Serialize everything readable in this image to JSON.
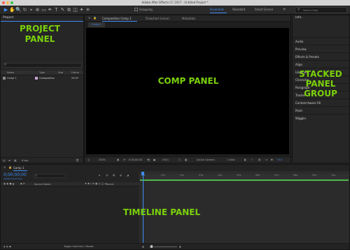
{
  "app": {
    "title": "Adobe After Effects CC 2017 - Untitled Project *"
  },
  "toolbar": {
    "snapping": "Snapping",
    "workspaces": [
      "Essentials",
      "Standard",
      "Small Screen"
    ],
    "active_workspace": "Essentials",
    "search_placeholder": "Search Help"
  },
  "project": {
    "panel_title": "Project",
    "overlay_label": "PROJECT\nPANEL",
    "search_icon": "search-icon",
    "columns": [
      "Name",
      "Type",
      "Size",
      "Frame"
    ],
    "rows": [
      {
        "name": "Comp 1",
        "type": "Composition",
        "frame": "29.97"
      }
    ],
    "footer_bpc": "8 bpc"
  },
  "comp": {
    "tabs": [
      "Composition Comp 1",
      "Flowchart (none)",
      "Metadata"
    ],
    "subtab": "Comp 1",
    "overlay_label": "COMP PANEL",
    "footer": {
      "zoom": "200%",
      "timecode": "0;00;00;00",
      "resolution": "(Full)",
      "camera": "Active Camera",
      "view": "1 View",
      "exposure": "+0.0"
    }
  },
  "right_panels": {
    "header": "Info",
    "items": [
      "Audio",
      "Preview",
      "Effects & Presets",
      "Align",
      "Libraries",
      "Character",
      "Paragraph",
      "Tracker",
      "Content-Aware Fill",
      "Paint",
      "Wiggler"
    ],
    "overlay_label": "STACKED\nPANEL\nGROUP"
  },
  "timeline": {
    "tab": "Comp 1",
    "timecode": "0;00;00;00",
    "fps_hint": "00000 (29.97 fps)",
    "search_icon": "search-icon",
    "column_source": "Source Name",
    "column_parent": "Parent",
    "ruler_ticks": [
      "0s",
      "01s",
      "02s",
      "03s",
      "04s",
      "05s",
      "06s",
      "07s",
      "08s",
      "09s",
      "10s"
    ],
    "overlay_label": "TIMELINE PANEL",
    "footer_toggle": "Toggle Switches / Modes"
  },
  "colors": {
    "accent_blue": "#3d8df5",
    "overlay_green": "#7bd10b",
    "work_area_green": "#4fb84a"
  }
}
